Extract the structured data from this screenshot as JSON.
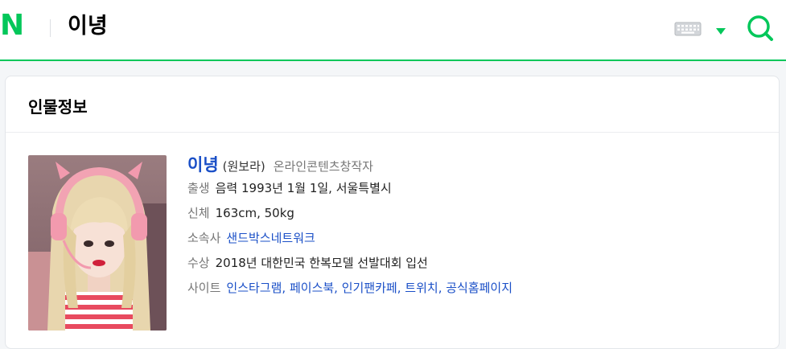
{
  "header": {
    "logo": "N",
    "query": "이녕"
  },
  "card": {
    "title": "인물정보",
    "name": "이녕",
    "original_name": "(원보라)",
    "occupation": "온라인콘텐츠창작자",
    "rows": {
      "birth": {
        "label": "출생",
        "value": "음력 1993년 1월 1일, 서울특별시"
      },
      "body": {
        "label": "신체",
        "value": "163cm, 50kg"
      },
      "agency": {
        "label": "소속사",
        "value": "샌드박스네트워크"
      },
      "award": {
        "label": "수상",
        "value": "2018년 대한민국 한복모델 선발대회 입선"
      },
      "site": {
        "label": "사이트",
        "links": [
          "인스타그램",
          "페이스북",
          "인기팬카페",
          "트위치",
          "공식홈페이지"
        ],
        "separator": ", "
      }
    }
  },
  "colors": {
    "brand_green": "#03c75a",
    "link_blue": "#1a4fc7",
    "label_gray": "#767676"
  },
  "icons": [
    "keyboard-icon",
    "dropdown-caret-icon",
    "search-icon"
  ]
}
